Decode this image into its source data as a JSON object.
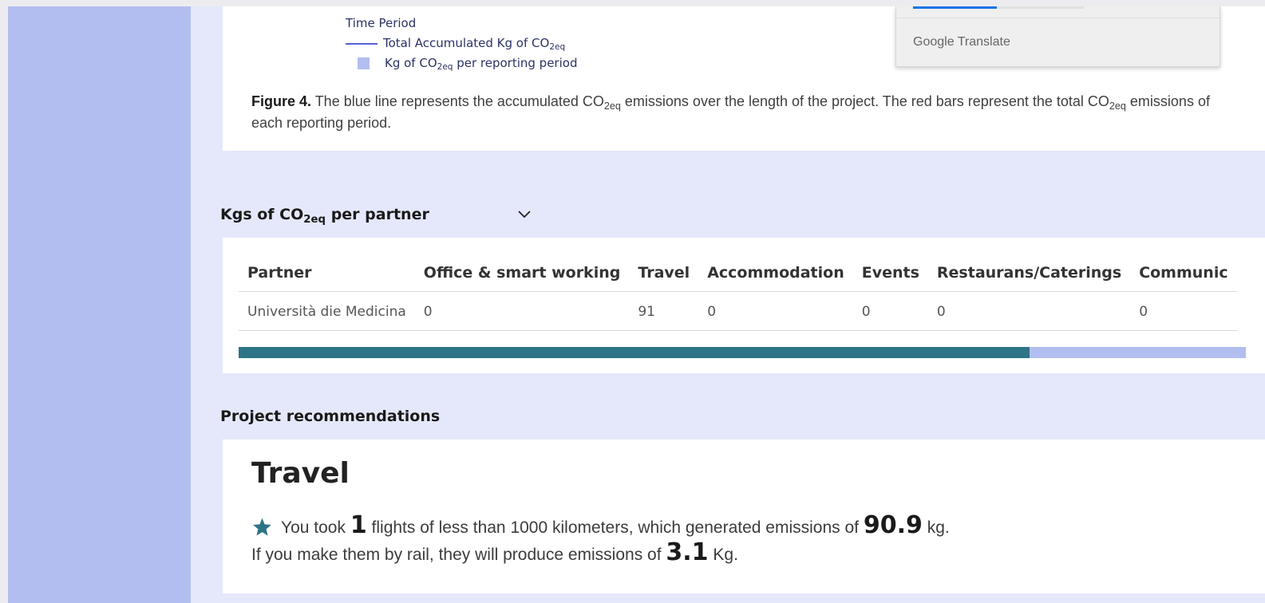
{
  "colors": {
    "sidebar": "#b3bef0",
    "background": "#e5e8fb",
    "accent_teal": "#2d7487",
    "legend_line": "#5563d8"
  },
  "legend": {
    "title": "Time Period",
    "line_label_prefix": "Total Accumulated Kg of CO",
    "line_label_sub": "2eq",
    "bar_label_prefix": "Kg of CO",
    "bar_label_sub": "2eq",
    "bar_label_suffix": " per reporting period"
  },
  "caption": {
    "bold": "Figure 4.",
    "text1": " The blue line represents the accumulated CO",
    "sub1": "2eq",
    "text2": " emissions over the length of the project. The red bars represent the total CO",
    "sub2": "2eq",
    "text3": " emissions of each reporting period."
  },
  "google_translate": {
    "brand": "Google Translate"
  },
  "partner_section": {
    "heading_prefix": "Kgs of CO",
    "heading_sub": "2eq",
    "heading_suffix": " per partner",
    "toggle_icon": "chevron-down-icon",
    "columns": [
      "Partner",
      "Office & smart working",
      "Travel",
      "Accommodation",
      "Events",
      "Restaurans/Caterings",
      "Communic"
    ],
    "rows": [
      [
        "Università die Medicina",
        "0",
        "91",
        "0",
        "0",
        "0",
        "0"
      ]
    ],
    "scroll_position": 0.785
  },
  "recommendations": {
    "heading": "Project recommendations",
    "title": "Travel",
    "icon": "star-icon",
    "line1_a": "You took ",
    "line1_flights": "1",
    "line1_b": " flights of less than 1000 kilometers, which generated emissions of ",
    "line1_kg": "90.9",
    "line1_c": " kg.",
    "line2_a": "If you make them by rail, they will produce emissions of ",
    "line2_kg": "3.1",
    "line2_b": " Kg."
  }
}
